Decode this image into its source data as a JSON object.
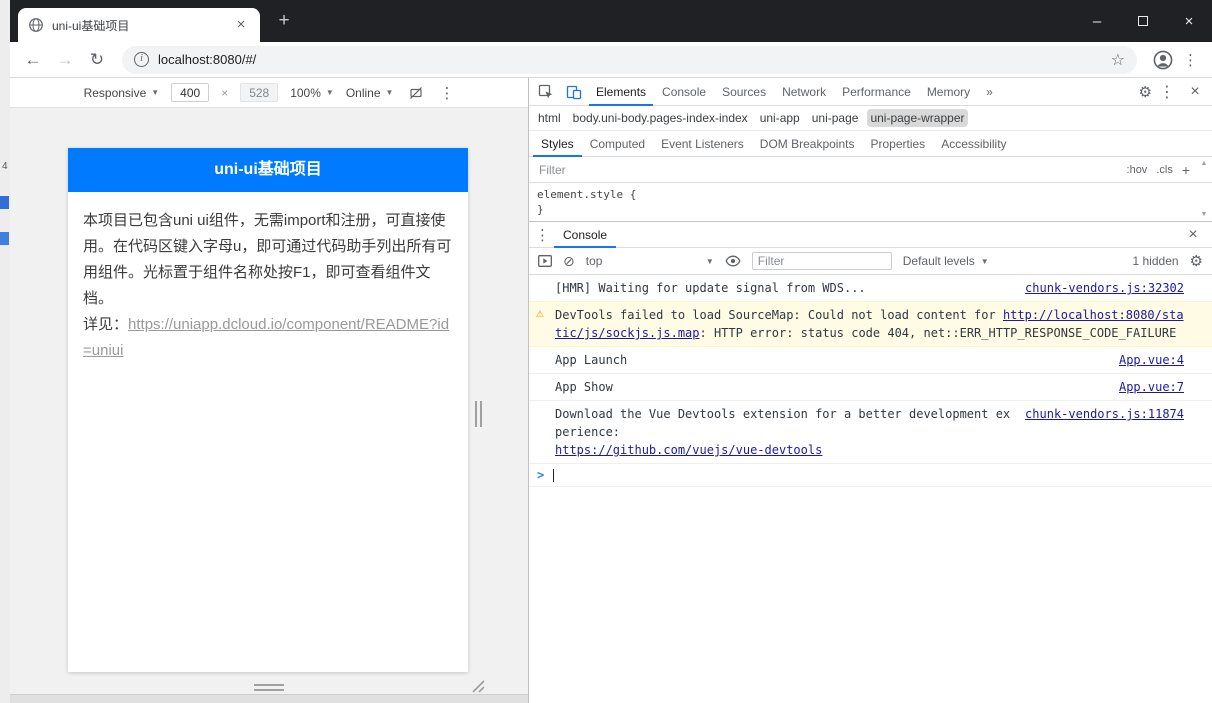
{
  "colors": {
    "page_header_blue": "#007aff",
    "devtools_accent": "#1a73e8",
    "warning_bg": "#fffbe5",
    "titlebar": "#202124"
  },
  "desktop": {
    "edge_label": "4"
  },
  "window": {
    "tab_title": "uni-ui基础项目",
    "url": "localhost:8080/#/"
  },
  "icons": {
    "close": "×",
    "plus": "+",
    "minimize": "–",
    "back": "←",
    "forward": "→",
    "reload": "↻",
    "menu": "⋮",
    "star": "☆",
    "caret": "▼",
    "more_tabs": "»",
    "clear": "⊘",
    "warning": "⚠",
    "gear": "⚙",
    "info": "i",
    "scroll_up": "▲",
    "scroll_down": "▼"
  },
  "device_toolbar": {
    "mode": "Responsive",
    "width": "400",
    "times": "×",
    "height": "528",
    "zoom": "100%",
    "network": "Online"
  },
  "devtools": {
    "tabs": [
      "Elements",
      "Console",
      "Sources",
      "Network",
      "Performance",
      "Memory"
    ],
    "more_tabs": "»",
    "breadcrumbs": [
      "html",
      "body.uni-body.pages-index-index",
      "uni-app",
      "uni-page",
      "uni-page-wrapper"
    ],
    "sidebar_tabs": [
      "Styles",
      "Computed",
      "Event Listeners",
      "DOM Breakpoints",
      "Properties",
      "Accessibility"
    ],
    "styles_filter_placeholder": "Filter",
    "hov": ":hov",
    "cls": ".cls",
    "add": "+",
    "element_style": "element.style {",
    "close_brace": "}"
  },
  "console": {
    "tab_label": "Console",
    "context": "top",
    "filter_placeholder": "Filter",
    "levels": "Default levels",
    "hidden_count": "1 hidden",
    "prompt": ">",
    "messages": {
      "hmr": {
        "text": "[HMR] Waiting for update signal from WDS...",
        "source": "chunk-vendors.js:32302"
      },
      "sourcemap_warning": {
        "part1": "DevTools failed to load SourceMap: Could not load content for ",
        "url": "http://localhost:8080/static/js/sockjs.js.map",
        "part2": ": HTTP error: status code 404, ",
        "part3": "net::ERR_HTTP_RESPONSE_CODE_FAILURE"
      },
      "app_launch": {
        "text": "App Launch",
        "source": "App.vue:4"
      },
      "app_show": {
        "text": "App Show",
        "source": "App.vue:7"
      },
      "vue_devtools": {
        "text": "Download the Vue Devtools extension for a better development experience:",
        "url": "https://github.com/vuejs/vue-devtools",
        "source": "chunk-vendors.js:11874"
      }
    }
  },
  "page": {
    "title": "uni-ui基础项目",
    "body": "本项目已包含uni ui组件，无需import和注册，可直接使用。在代码区键入字母u，即可通过代码助手列出所有可用组件。光标置于组件名称处按F1，即可查看组件文档。",
    "see_label": "详见：",
    "doc_link": "https://uniapp.dcloud.io/component/README?id=uniui"
  }
}
